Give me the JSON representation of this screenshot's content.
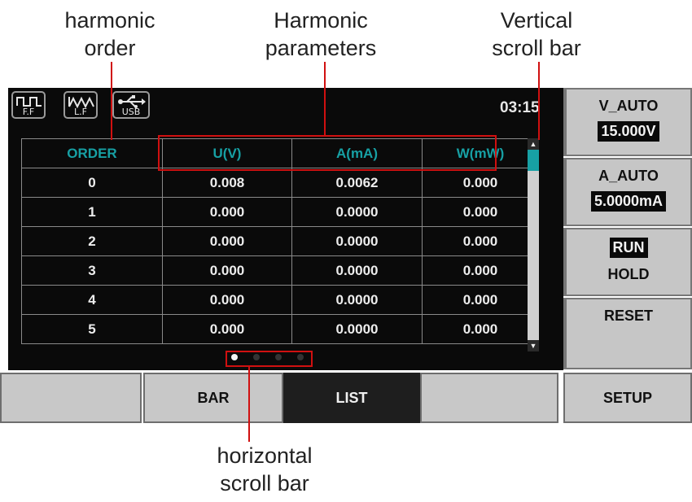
{
  "annotations": {
    "harmonic_order": [
      "harmonic",
      "order"
    ],
    "harmonic_parameters": [
      "Harmonic",
      "parameters"
    ],
    "vertical_scroll_bar": [
      "Vertical",
      "scroll bar"
    ],
    "horizontal_scroll_bar": [
      "horizontal",
      "scroll bar"
    ]
  },
  "status_bar": {
    "icons": [
      {
        "name": "ff-waveform-icon",
        "label": "F.F"
      },
      {
        "name": "lf-waveform-icon",
        "label": "L.F"
      },
      {
        "name": "usb-icon",
        "label": "USB"
      }
    ],
    "time": "03:15"
  },
  "table": {
    "headers": [
      "ORDER",
      "U(V)",
      "A(mA)",
      "W(mW)"
    ],
    "rows": [
      [
        "0",
        "0.008",
        "0.0062",
        "0.000"
      ],
      [
        "1",
        "0.000",
        "0.0000",
        "0.000"
      ],
      [
        "2",
        "0.000",
        "0.0000",
        "0.000"
      ],
      [
        "3",
        "0.000",
        "0.0000",
        "0.000"
      ],
      [
        "4",
        "0.000",
        "0.0000",
        "0.000"
      ],
      [
        "5",
        "0.000",
        "0.0000",
        "0.000"
      ]
    ]
  },
  "horizontal_pages": {
    "count": 4,
    "current": 1
  },
  "softkeys": [
    "",
    "BAR",
    "LIST",
    "",
    "SETUP"
  ],
  "active_softkey": "LIST",
  "sidekeys": {
    "v_range_label": "V_AUTO",
    "v_range_value": "15.000V",
    "a_range_label": "A_AUTO",
    "a_range_value": "5.0000mA",
    "run_label": "RUN",
    "hold_label": "HOLD",
    "reset_label": "RESET"
  },
  "colors": {
    "header_teal": "#17a0a4",
    "annotation_red": "#d01010",
    "screen_bg": "#0a0a0a"
  }
}
